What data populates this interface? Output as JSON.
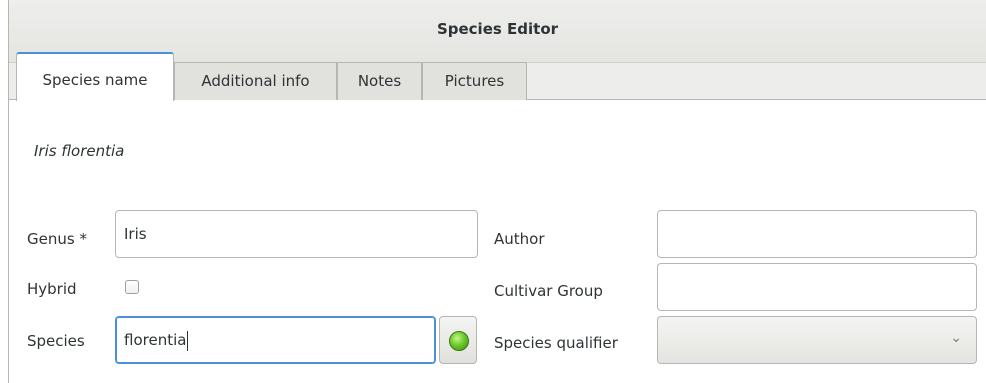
{
  "window": {
    "title": "Species Editor"
  },
  "tabs": [
    {
      "label": "Species name",
      "active": true
    },
    {
      "label": "Additional info",
      "active": false
    },
    {
      "label": "Notes",
      "active": false
    },
    {
      "label": "Pictures",
      "active": false
    }
  ],
  "species_name": {
    "full_name": "Iris florentia",
    "genus": {
      "label": "Genus *",
      "value": "Iris"
    },
    "hybrid": {
      "label": "Hybrid",
      "checked": false
    },
    "species": {
      "label": "Species",
      "value": "florentia",
      "status": "valid"
    },
    "author": {
      "label": "Author",
      "value": ""
    },
    "cultivar_group": {
      "label": "Cultivar Group",
      "value": ""
    },
    "species_qualifier": {
      "label": "Species qualifier",
      "value": ""
    }
  },
  "colors": {
    "accent": "#4a90d9",
    "status_ok": "#6cc92c"
  },
  "icons": {
    "combo_arrow": "chevron-down-icon",
    "status": "green-status-led-icon"
  }
}
